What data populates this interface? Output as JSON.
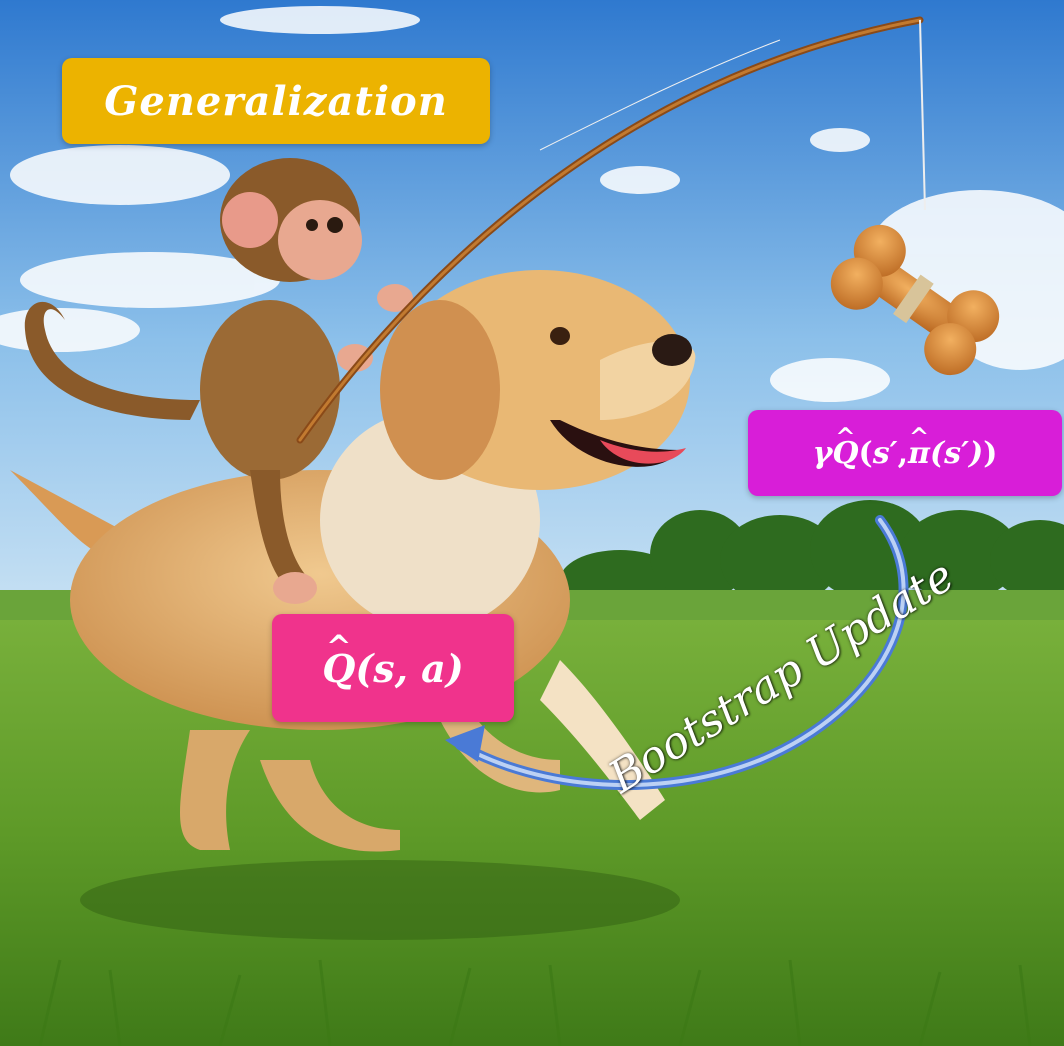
{
  "labels": {
    "generalization": "Generalization",
    "target": {
      "gamma": "γ",
      "q_hat": "Q",
      "open": "(",
      "s_prime": "s′",
      "comma": ",",
      "pi_hat": "π",
      "pi_arg": "(s′)",
      "close": ")"
    },
    "current_q": {
      "q_hat": "Q",
      "args": "(s, a)"
    },
    "bootstrap": "Bootstrap Update"
  },
  "colors": {
    "generalization_box": "#ecb300",
    "target_box": "#d81ed8",
    "q_box": "#f0338c",
    "arrow": "#4a7ad6",
    "sky_top": "#3f87d6",
    "grass": "#5f9a2a"
  },
  "icons": [
    "monkey-figure",
    "dog-figure",
    "fishing-rod",
    "bone-treat",
    "trees"
  ]
}
